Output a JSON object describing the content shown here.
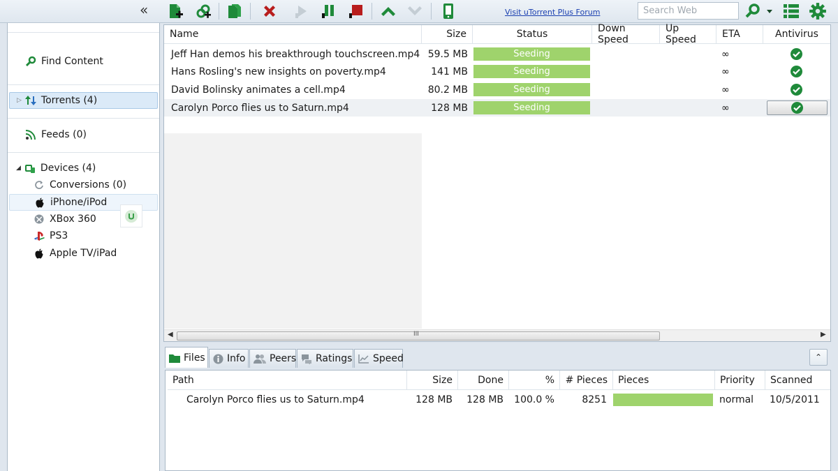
{
  "toolbar": {
    "collapse_label": "«",
    "forum_link": "Visit uTorrent Plus Forum",
    "search_placeholder": "Search Web",
    "icons": [
      "add-torrent-icon",
      "add-url-icon",
      "create-torrent-icon",
      "remove-icon",
      "start-icon",
      "pause-icon",
      "stop-icon",
      "move-up-icon",
      "move-down-icon",
      "device-icon",
      "search-icon",
      "list-view-icon",
      "settings-icon"
    ],
    "colors": {
      "green": "#1f8a3a",
      "red": "#b81d1d",
      "gray": "#b9c4cc"
    }
  },
  "sidebar": {
    "find_content": "Find Content",
    "torrents": "Torrents (4)",
    "feeds": "Feeds (0)",
    "devices": "Devices (4)",
    "device_items": [
      "Conversions (0)",
      "iPhone/iPod",
      "XBox 360",
      "PS3",
      "Apple TV/iPad"
    ]
  },
  "list": {
    "columns": [
      "Name",
      "Size",
      "Status",
      "Down Speed",
      "Up Speed",
      "ETA",
      "Antivirus"
    ],
    "rows": [
      {
        "name": "Jeff Han demos his breakthrough touchscreen.mp4",
        "size": "59.5 MB",
        "status": "Seeding",
        "eta": "∞"
      },
      {
        "name": "Hans Rosling's new insights on poverty.mp4",
        "size": "141 MB",
        "status": "Seeding",
        "eta": "∞"
      },
      {
        "name": "David Bolinsky animates a cell.mp4",
        "size": "80.2 MB",
        "status": "Seeding",
        "eta": "∞"
      },
      {
        "name": "Carolyn Porco flies us to Saturn.mp4",
        "size": "128 MB",
        "status": "Seeding",
        "eta": "∞"
      }
    ],
    "scroll_grip": "III"
  },
  "tabs": [
    "Files",
    "Info",
    "Peers",
    "Ratings",
    "Speed"
  ],
  "expand_label": "⌃",
  "files": {
    "columns": [
      "Path",
      "Size",
      "Done",
      "%",
      "# Pieces",
      "Pieces",
      "Priority",
      "Scanned"
    ],
    "row": {
      "path": "Carolyn Porco flies us to Saturn.mp4",
      "size": "128 MB",
      "done": "128 MB",
      "percent": "100.0 %",
      "pieces": "8251",
      "pieces_progress": 1.0,
      "priority": "normal",
      "scanned": "10/5/2011"
    }
  }
}
